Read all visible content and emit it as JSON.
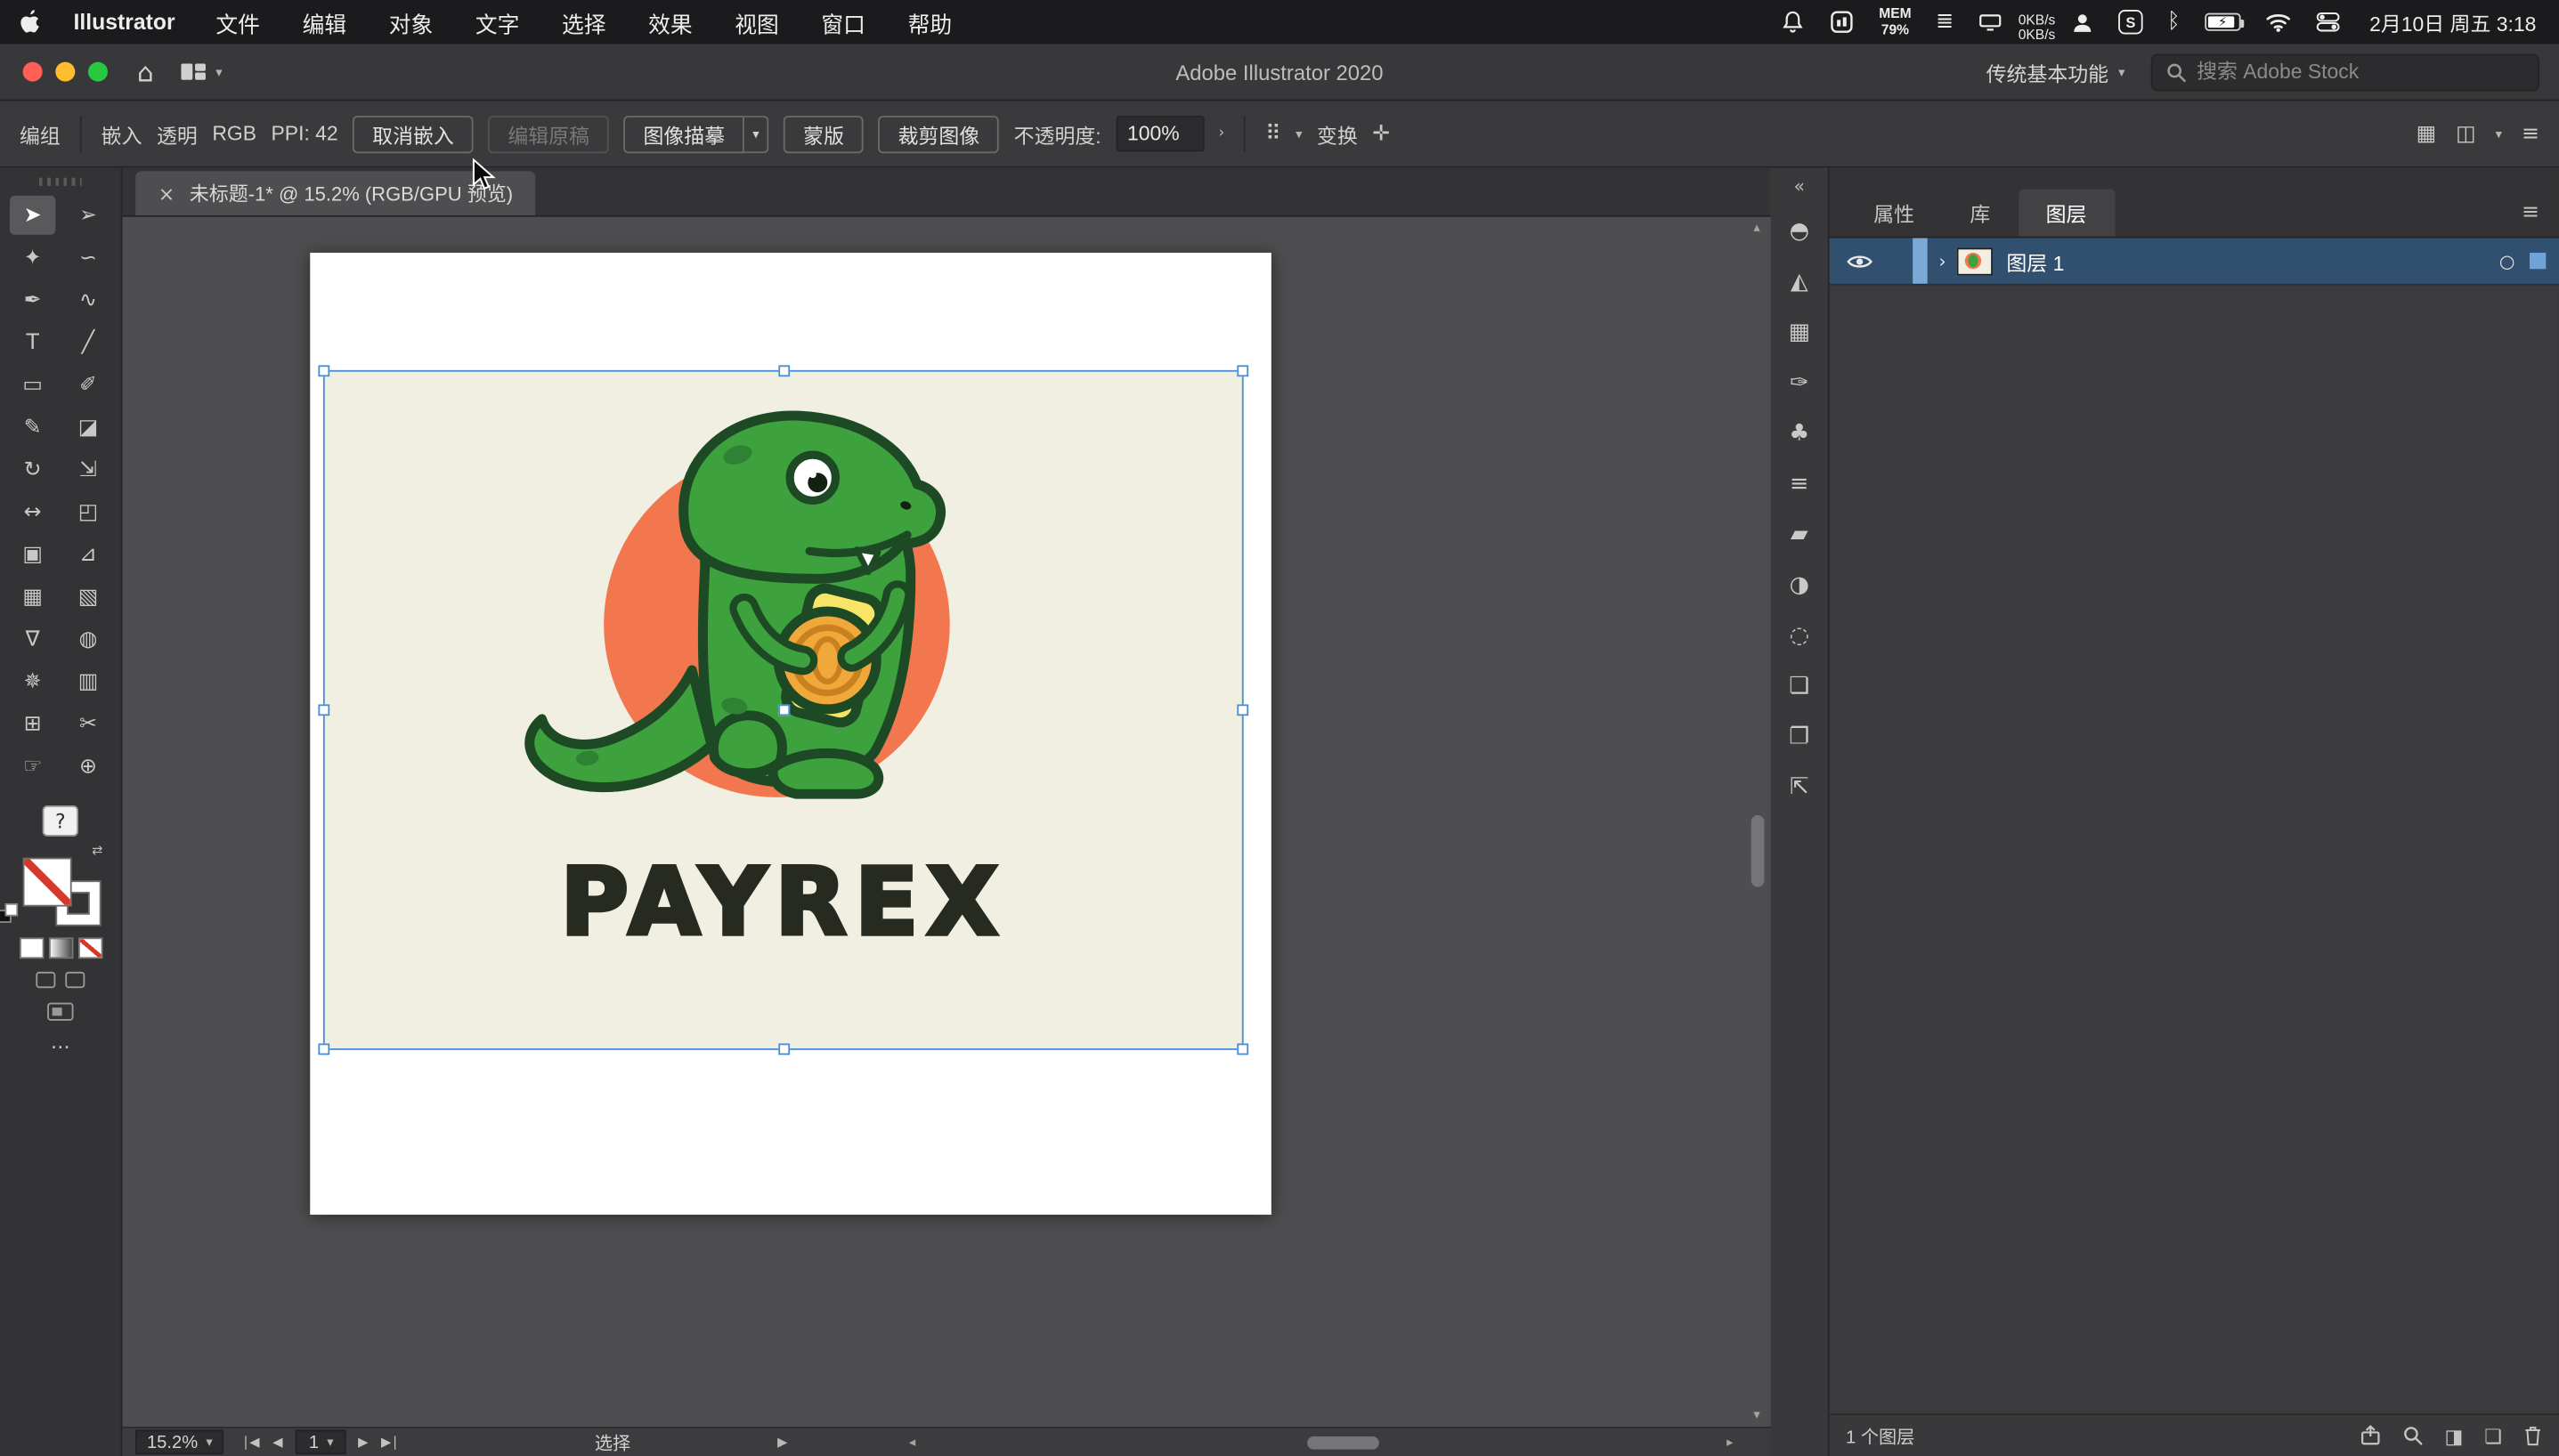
{
  "colors": {
    "accent": "#4a8fd6",
    "menubar_bg": "#1b1b1d",
    "titlebar_bg": "#38383a",
    "controlbar_bg": "#3a3a3c",
    "toolbar_bg": "#333335",
    "canvas_bg": "#4e4e50",
    "panel_bg": "#39393b",
    "layer_row_blue": "#31506f",
    "layer_row_bar": "#7aa9d6",
    "logo_bg": "#f0efe2",
    "logo_orange": "#f2774e",
    "dino_green": "#3da23e",
    "dino_outline": "#1d4a25",
    "dino_spot": "#2f8133",
    "coin_gold": "#f0a83a",
    "coin_ring": "#c9811f",
    "note_yellow": "#f8e565",
    "brand_text_color": "#262a20",
    "traffic_red": "#ff5f57",
    "traffic_yellow": "#febc2e",
    "traffic_green": "#28c840"
  },
  "icons": {
    "chevron_down": "▾",
    "chevron_right": "›",
    "flyout": "▶",
    "scroll_up": "▴",
    "scroll_down": "▾",
    "scroll_left": "◂",
    "scroll_right": "▸",
    "collapse": "«",
    "close": "×",
    "menu": "≡",
    "more": "⋯",
    "help": "?",
    "home": "⌂",
    "nav_first": "|◀",
    "nav_prev": "◀",
    "nav_next": "▶",
    "nav_last": "▶|",
    "target": "○",
    "dotted_grid": "⠿",
    "transform_icon": "✛",
    "arrange_icon": "▦",
    "panel_toggle_icon": "◫",
    "bolt": "⚡",
    "bluetooth": "ᛒ",
    "stack": "≣",
    "clip_mask": "◨",
    "new_layer": "❏",
    "s_badge": "S",
    "layer_chevron": "›",
    "swap": "⇄"
  },
  "menubar": {
    "app_name": "Illustrator",
    "menus": [
      {
        "name": "file-menu",
        "label": "文件"
      },
      {
        "name": "edit-menu",
        "label": "编辑"
      },
      {
        "name": "object-menu",
        "label": "对象"
      },
      {
        "name": "type-menu",
        "label": "文字"
      },
      {
        "name": "select-menu",
        "label": "选择"
      },
      {
        "name": "effect-menu",
        "label": "效果"
      },
      {
        "name": "view-menu",
        "label": "视图"
      },
      {
        "name": "window-menu",
        "label": "窗口"
      },
      {
        "name": "help-menu",
        "label": "帮助"
      }
    ],
    "status": {
      "mem_label": "MEM",
      "mem_value": "79%",
      "net_up": "0KB/s",
      "net_down": "0KB/s",
      "clock": "2月10日 周五 3:18"
    }
  },
  "titlebar": {
    "title": "Adobe Illustrator 2020",
    "workspace": "传统基本功能",
    "search_placeholder": "搜索 Adobe Stock"
  },
  "controlbar": {
    "context_label": "编组",
    "embed_label": "嵌入",
    "transparent_label": "透明",
    "color_mode": "RGB",
    "ppi_label": "PPI: 42",
    "unembed_button": "取消嵌入",
    "edit_original_button": "编辑原稿",
    "image_trace_button": "图像描摹",
    "mask_button": "蒙版",
    "crop_button": "裁剪图像",
    "opacity_label": "不透明度:",
    "opacity_value": "100%",
    "transform_label": "变换"
  },
  "document_tab": {
    "title": "未标题-1* @ 15.2% (RGB/GPU 预览)"
  },
  "tools": [
    {
      "name": "selection-tool",
      "glyph": "➤",
      "active": true
    },
    {
      "name": "direct-selection-tool",
      "glyph": "➢"
    },
    {
      "name": "magic-wand-tool",
      "glyph": "✦"
    },
    {
      "name": "lasso-tool",
      "glyph": "∽"
    },
    {
      "name": "pen-tool",
      "glyph": "✒"
    },
    {
      "name": "curvature-tool",
      "glyph": "∿"
    },
    {
      "name": "type-tool",
      "glyph": "T"
    },
    {
      "name": "line-segment-tool",
      "glyph": "╱"
    },
    {
      "name": "rectangle-tool",
      "glyph": "▭"
    },
    {
      "name": "paintbrush-tool",
      "glyph": "✐"
    },
    {
      "name": "pencil-tool",
      "glyph": "✎"
    },
    {
      "name": "eraser-tool",
      "glyph": "◪"
    },
    {
      "name": "rotate-tool",
      "glyph": "↻"
    },
    {
      "name": "scale-tool",
      "glyph": "⇲"
    },
    {
      "name": "width-tool",
      "glyph": "↔"
    },
    {
      "name": "free-transform-tool",
      "glyph": "◰"
    },
    {
      "name": "shape-builder-tool",
      "glyph": "▣"
    },
    {
      "name": "perspective-grid-tool",
      "glyph": "⊿"
    },
    {
      "name": "mesh-tool",
      "glyph": "▦"
    },
    {
      "name": "gradient-tool",
      "glyph": "▧"
    },
    {
      "name": "eyedropper-tool",
      "glyph": "∇"
    },
    {
      "name": "blend-tool",
      "glyph": "◍"
    },
    {
      "name": "symbol-sprayer-tool",
      "glyph": "✵"
    },
    {
      "name": "column-graph-tool",
      "glyph": "▥"
    },
    {
      "name": "artboard-tool",
      "glyph": "⊞"
    },
    {
      "name": "slice-tool",
      "glyph": "✂"
    },
    {
      "name": "hand-tool",
      "glyph": "☞"
    },
    {
      "name": "zoom-tool",
      "glyph": "⊕"
    }
  ],
  "panel_strip": [
    {
      "name": "color-panel-icon",
      "glyph": "◓"
    },
    {
      "name": "gradient-panel-icon",
      "glyph": "◭"
    },
    {
      "name": "swatches-panel-icon",
      "glyph": "▦"
    },
    {
      "name": "brushes-panel-icon",
      "glyph": "✑"
    },
    {
      "name": "symbols-panel-icon",
      "glyph": "♣"
    },
    {
      "name": "stroke-panel-icon",
      "glyph": "≡"
    },
    {
      "name": "appearance-panel-icon",
      "glyph": "▰"
    },
    {
      "name": "transparency-panel-icon",
      "glyph": "◑"
    },
    {
      "name": "graphic-styles-panel-icon",
      "glyph": "◌"
    },
    {
      "name": "artboards-panel-icon",
      "glyph": "❏"
    },
    {
      "name": "layers-panel-icon",
      "glyph": "❐"
    },
    {
      "name": "asset-export-panel-icon",
      "glyph": "⇱"
    }
  ],
  "right_panel": {
    "tabs": [
      {
        "name": "properties-tab",
        "label": "属性"
      },
      {
        "name": "libraries-tab",
        "label": "库"
      },
      {
        "name": "layers-tab",
        "label": "图层",
        "active": true
      }
    ],
    "layer_row": {
      "name": "图层 1"
    },
    "footer_count": "1 个图层"
  },
  "statusbar": {
    "zoom": "15.2%",
    "artboard": "1",
    "status": "选择"
  },
  "artwork": {
    "brand_text": "PAYREX"
  }
}
